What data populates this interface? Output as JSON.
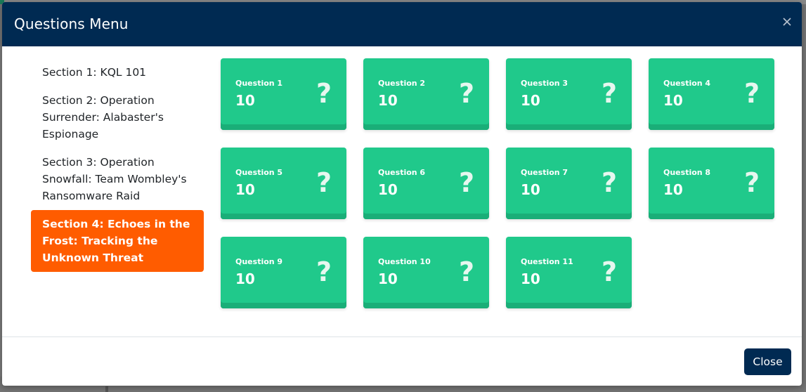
{
  "modal": {
    "title": "Questions Menu",
    "close_icon": "close-icon",
    "close_button_label": "Close"
  },
  "sections": [
    {
      "label": "Section 1: KQL 101",
      "active": false
    },
    {
      "label": "Section 2: Operation Surrender: Alabaster's Espionage",
      "active": false
    },
    {
      "label": "Section 3: Operation Snowfall: Team Wombley's Ransomware Raid",
      "active": false
    },
    {
      "label": "Section 4: Echoes in the Frost: Tracking the Unknown Threat",
      "active": true
    }
  ],
  "questions": [
    {
      "label": "Question 1",
      "points": "10",
      "mark": "?"
    },
    {
      "label": "Question 2",
      "points": "10",
      "mark": "?"
    },
    {
      "label": "Question 3",
      "points": "10",
      "mark": "?"
    },
    {
      "label": "Question 4",
      "points": "10",
      "mark": "?"
    },
    {
      "label": "Question 5",
      "points": "10",
      "mark": "?"
    },
    {
      "label": "Question 6",
      "points": "10",
      "mark": "?"
    },
    {
      "label": "Question 7",
      "points": "10",
      "mark": "?"
    },
    {
      "label": "Question 8",
      "points": "10",
      "mark": "?"
    },
    {
      "label": "Question 9",
      "points": "10",
      "mark": "?"
    },
    {
      "label": "Question 10",
      "points": "10",
      "mark": "?"
    },
    {
      "label": "Question 11",
      "points": "10",
      "mark": "?"
    }
  ],
  "colors": {
    "header_bg": "#002a52",
    "active_section_bg": "#ff5c00",
    "question_card_bg": "#20c98b",
    "close_button_bg": "#002a52"
  }
}
